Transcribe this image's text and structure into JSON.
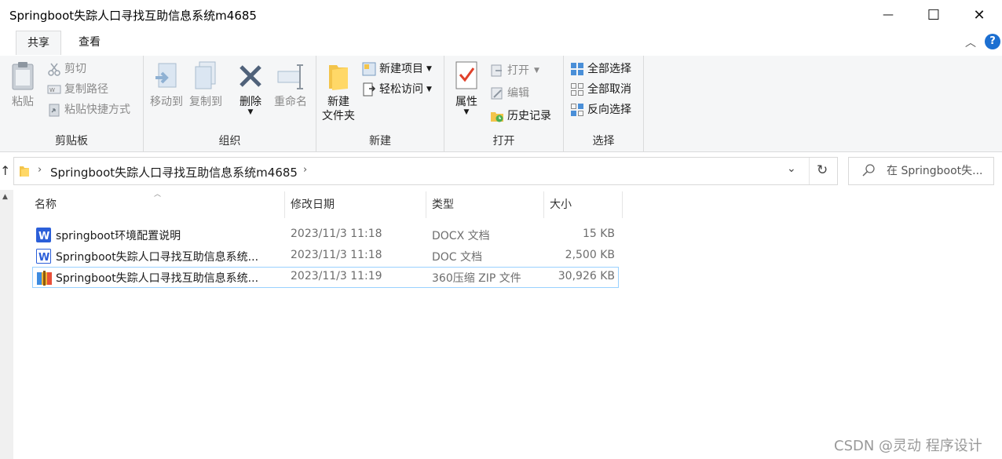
{
  "window": {
    "title": "Springboot失踪人口寻找互助信息系统m4685",
    "minimize": "—",
    "maximize": "☐",
    "close": "✕"
  },
  "tabs": [
    {
      "label": "共享",
      "active": true
    },
    {
      "label": "查看",
      "active": false
    }
  ],
  "ribbon": {
    "clipboard": {
      "label": "剪贴板",
      "paste": "粘贴",
      "cut": "剪切",
      "copy_path": "复制路径",
      "paste_shortcut": "粘贴快捷方式"
    },
    "organize": {
      "label": "组织",
      "move_to": "移动到",
      "copy_to": "复制到",
      "delete": "删除",
      "rename": "重命名"
    },
    "new": {
      "label": "新建",
      "new_folder": "新建\n文件夹",
      "new_item": "新建项目",
      "easy_access": "轻松访问"
    },
    "open": {
      "label": "打开",
      "properties": "属性",
      "open": "打开",
      "edit": "编辑",
      "history": "历史记录"
    },
    "select": {
      "label": "选择",
      "select_all": "全部选择",
      "select_none": "全部取消",
      "invert": "反向选择"
    }
  },
  "address": {
    "path": "Springboot失踪人口寻找互助信息系统m4685",
    "search_placeholder": "在 Springboot失..."
  },
  "columns": {
    "name": "名称",
    "modified": "修改日期",
    "type": "类型",
    "size": "大小"
  },
  "files": [
    {
      "name": "springboot环境配置说明",
      "modified": "2023/11/3 11:18",
      "type": "DOCX 文档",
      "size": "15 KB",
      "icon": "word-docx-icon"
    },
    {
      "name": "Springboot失踪人口寻找互助信息系统...",
      "modified": "2023/11/3 11:18",
      "type": "DOC 文档",
      "size": "2,500 KB",
      "icon": "word-doc-icon"
    },
    {
      "name": "Springboot失踪人口寻找互助信息系统...",
      "modified": "2023/11/3 11:19",
      "type": "360压缩 ZIP 文件",
      "size": "30,926 KB",
      "icon": "zip-archive-icon",
      "selected": true
    }
  ],
  "watermark": "CSDN @灵动 程序设计",
  "colors": {
    "accent": "#1c6fd1",
    "selection_border": "#99d1ff",
    "ribbon_bg": "#f5f6f7"
  }
}
